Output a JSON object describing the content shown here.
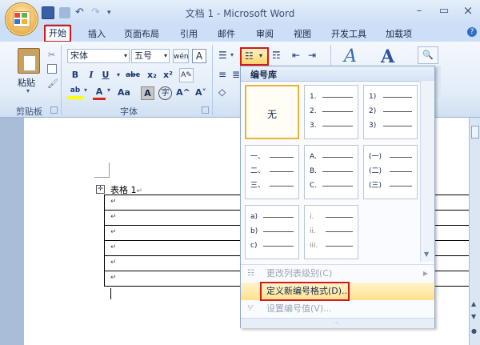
{
  "window": {
    "title": "文档 1 - Microsoft Word",
    "minimize": "–",
    "maximize": "▭",
    "close": "×"
  },
  "tabs": [
    "开始",
    "插入",
    "页面布局",
    "引用",
    "邮件",
    "审阅",
    "视图",
    "开发工具",
    "加载项"
  ],
  "ribbon": {
    "paste_label": "粘贴",
    "clipboard_group": "剪贴板",
    "font_group": "字体",
    "font_name": "宋体",
    "font_size": "五号",
    "bold": "B",
    "italic": "I",
    "underline": "U",
    "strike": "abc",
    "subscript": "x₂",
    "superscript": "x²",
    "font_color": "A",
    "change_case": "Aa",
    "grow_font": "A^",
    "shrink_font": "A˅"
  },
  "document": {
    "caption": "表格 1",
    "paragraph_mark": "↵",
    "row_count": 6
  },
  "numbering_menu": {
    "header": "编号库",
    "cells": [
      {
        "type": "none",
        "label": "无"
      },
      {
        "lines": [
          "1.",
          "2.",
          "3."
        ]
      },
      {
        "lines": [
          "1)",
          "2)",
          "3)"
        ]
      },
      {
        "lines": [
          "一、",
          "二、",
          "三、"
        ]
      },
      {
        "lines": [
          "A.",
          "B.",
          "C."
        ]
      },
      {
        "lines": [
          "(一)",
          "(二)",
          "(三)"
        ]
      },
      {
        "lines": [
          "a)",
          "b)",
          "c)"
        ]
      },
      {
        "lines": [
          "i.",
          "ii.",
          "iii."
        ]
      }
    ],
    "change_level": "更改列表级别(C)",
    "define_new": "定义新编号格式(D)...",
    "set_value": "设置编号值(V)..."
  },
  "colors": {
    "accent_red": "#d21a1a",
    "highlight": "#ffe08c",
    "ribbon_bg": "#e2ecf8"
  }
}
